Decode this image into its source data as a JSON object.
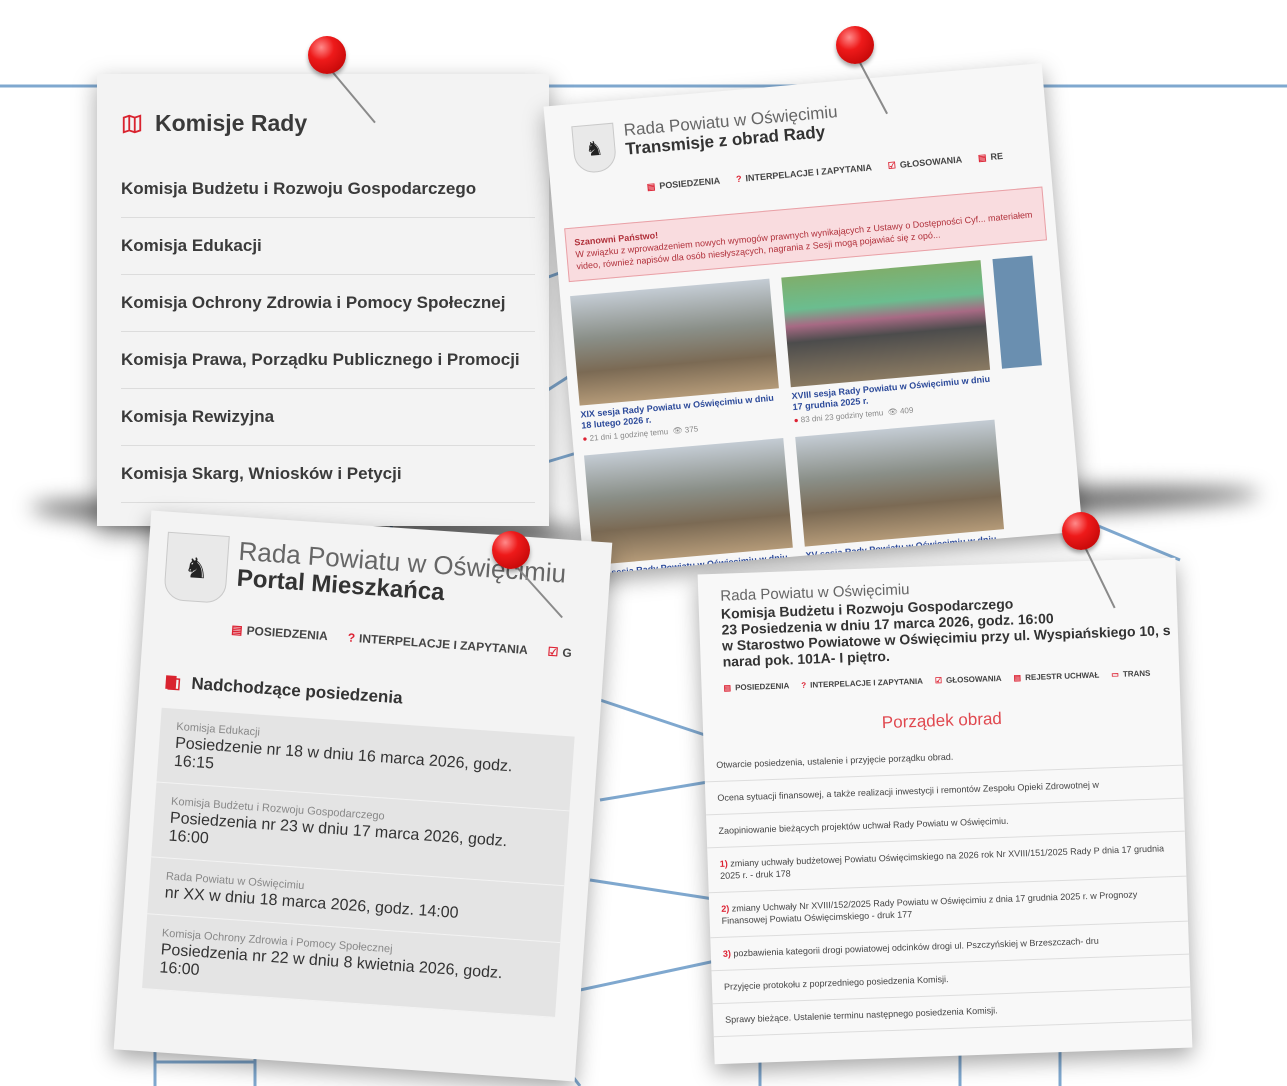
{
  "colors": {
    "accent": "#d9232f",
    "link": "#2c4a9a",
    "line": "#7fa8cf",
    "pin": "#e11d1d"
  },
  "komisje": {
    "title": "Komisje Rady",
    "items": [
      "Komisja Budżetu i Rozwoju Gospodarczego",
      "Komisja Edukacji",
      "Komisja Ochrony Zdrowia i Pomocy Społecznej",
      "Komisja Prawa, Porządku Publicznego i Promocji",
      "Komisja Rewizyjna",
      "Komisja Skarg, Wniosków i Petycji"
    ]
  },
  "transmisje": {
    "site": "Rada Powiatu w Oświęcimiu",
    "page": "Transmisje z obrad Rady",
    "nav": [
      "POSIEDZENIA",
      "INTERPELACJE I ZAPYTANIA",
      "GŁOSOWANIA",
      "RE"
    ],
    "alert_title": "Szanowni Państwo!",
    "alert_text": "W związku z wprowadzeniem nowych wymogów prawnych wynikających z Ustawy o Dostępności Cyf... materiałem video, również napisów dla osób niesłyszących, nagrania z Sesji mogą pojawiać się z opó...",
    "videos": [
      {
        "title": "XIX sesja Rady Powiatu w Oświęcimiu w dniu 18 lutego 2026 r.",
        "ago": "21 dni 1 godzinę temu",
        "views": "375"
      },
      {
        "title": "XVIII sesja Rady Powiatu w Oświęcimiu w dniu 17 grudnia 2025 r.",
        "ago": "83 dni 23 godziny temu",
        "views": "409"
      },
      {
        "title": "XVI sesja Rady Powiatu w Oświęcimiu w dniu 22 października 2025 r.",
        "ago": "",
        "views": ""
      },
      {
        "title": "XV sesja Rady Powiatu w Oświęcimiu w dniu 17 września 2025 r.",
        "ago": "",
        "views": ""
      }
    ]
  },
  "portal": {
    "site": "Rada Powiatu w Oświęcimiu",
    "page": "Portal Mieszkańca",
    "nav": [
      "POSIEDZENIA",
      "INTERPELACJE I ZAPYTANIA",
      "G"
    ],
    "section": "Nadchodzące posiedzenia",
    "meetings": [
      {
        "org": "Komisja Edukacji",
        "when": "Posiedzenie nr 18 w dniu 16 marca 2026, godz. 16:15"
      },
      {
        "org": "Komisja Budżetu i Rozwoju Gospodarczego",
        "when": "Posiedzenia nr 23 w dniu 17 marca 2026, godz. 16:00"
      },
      {
        "org": "Rada Powiatu w Oświęcimiu",
        "when": "nr XX w dniu 18 marca 2026, godz. 14:00"
      },
      {
        "org": "Komisja Ochrony Zdrowia i Pomocy Społecznej",
        "when": "Posiedzenia nr 22 w dniu 8 kwietnia 2026, godz. 16:00"
      }
    ]
  },
  "porzadek": {
    "site": "Rada Powiatu w Oświęcimiu",
    "title_line1": "Komisja Budżetu i Rozwoju Gospodarczego",
    "title_line2": "23 Posiedzenia w dniu 17 marca 2026, godz. 16:00",
    "title_line3": "w Starostwo Powiatowe w Oświęcimiu przy ul. Wyspiańskiego 10, s",
    "title_line4": "narad pok. 101A- I piętro.",
    "nav": [
      "POSIEDZENIA",
      "INTERPELACJE I ZAPYTANIA",
      "GŁOSOWANIA",
      "REJESTR UCHWAŁ",
      "TRANS"
    ],
    "heading": "Porządek obrad",
    "items": [
      {
        "num": "",
        "text": "Otwarcie posiedzenia, ustalenie i przyjęcie porządku obrad."
      },
      {
        "num": "",
        "text": "Ocena sytuacji finansowej, a także realizacji inwestycji i remontów Zespołu Opieki Zdrowotnej w"
      },
      {
        "num": "",
        "text": "Zaopiniowanie bieżących projektów uchwał Rady Powiatu w Oświęcimiu."
      },
      {
        "num": "1)",
        "text": "zmiany uchwały budżetowej Powiatu Oświęcimskiego na 2026 rok Nr XVIII/151/2025 Rady P dnia 17 grudnia 2025 r. - druk 178"
      },
      {
        "num": "2)",
        "text": "zmiany Uchwały Nr XVIII/152/2025 Rady Powiatu w Oświęcimiu z dnia 17 grudnia 2025 r. w Prognozy Finansowej Powiatu Oświęcimskiego - druk 177"
      },
      {
        "num": "3)",
        "text": "pozbawienia kategorii drogi powiatowej odcinków drogi ul. Pszczyńskiej w Brzeszczach- dru"
      },
      {
        "num": "",
        "text": "Przyjęcie protokołu z poprzedniego posiedzenia Komisji."
      },
      {
        "num": "",
        "text": "Sprawy bieżące. Ustalenie terminu następnego posiedzenia Komisji."
      }
    ]
  }
}
